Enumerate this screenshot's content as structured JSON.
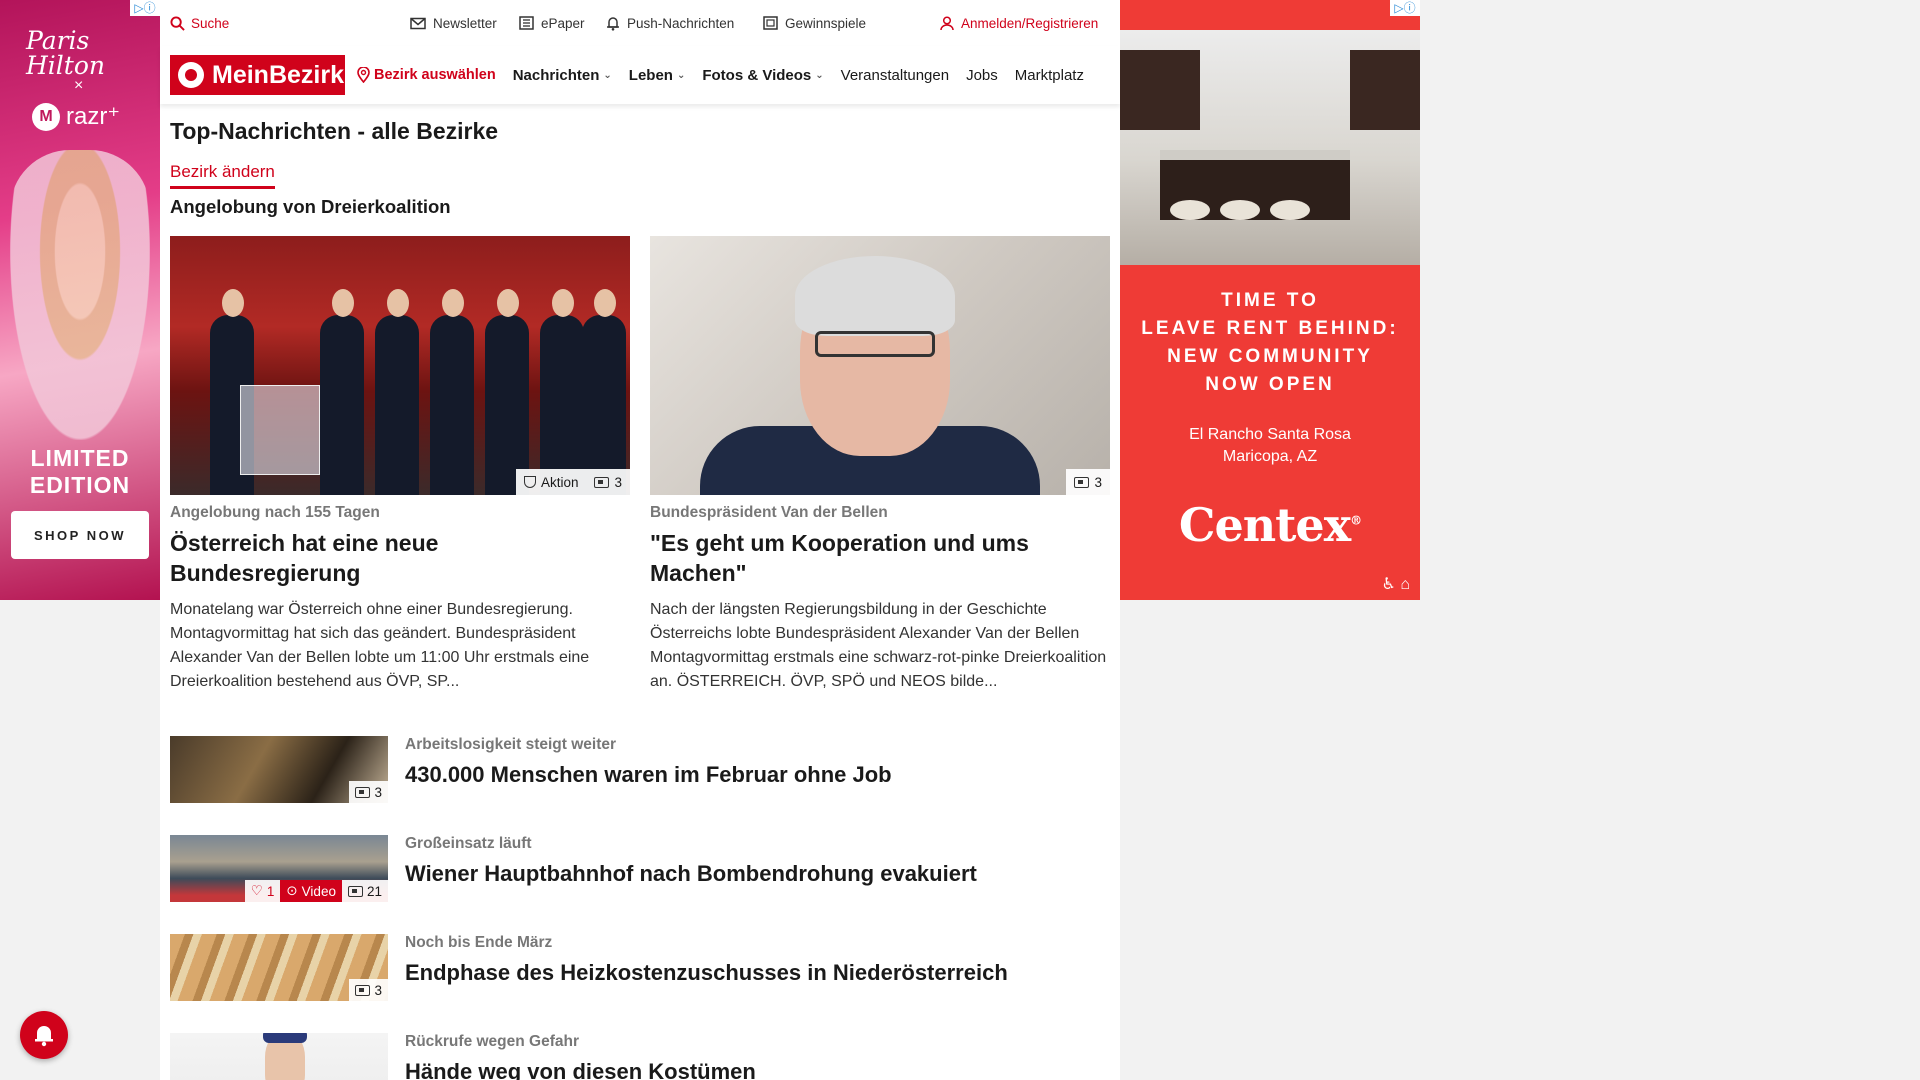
{
  "ads": {
    "left": {
      "brand": "Paris Hilton",
      "cross": "×",
      "partner": "razr⁺",
      "headline_line1": "LIMITED",
      "headline_line2": "EDITION",
      "cta": "SHOP NOW"
    },
    "right": {
      "headline_lines": [
        "TIME TO",
        "LEAVE RENT BEHIND:",
        "NEW COMMUNITY",
        "NOW OPEN"
      ],
      "location_line1": "El Rancho Santa Rosa",
      "location_line2": "Maricopa, AZ",
      "brand": "Centex",
      "brand_mark": "®"
    },
    "adchoice": "▷ⓘ"
  },
  "utility_bar": {
    "search": "Suche",
    "newsletter": "Newsletter",
    "epaper": "ePaper",
    "push": "Push-Nachrichten",
    "gewinnspiele": "Gewinnspiele",
    "login": "Anmelden/Registrieren"
  },
  "nav": {
    "logo": "MeinBezirk",
    "bezirk": "Bezirk auswählen",
    "items": [
      "Nachrichten",
      "Leben",
      "Fotos & Videos",
      "Veranstaltungen",
      "Jobs",
      "Marktplatz"
    ]
  },
  "page": {
    "title": "Top-Nachrichten - alle Bezirke",
    "change_bezirk": "Bezirk ändern",
    "section": "Angelobung von Dreierkoalition"
  },
  "hero_articles": [
    {
      "kicker": "Angelobung nach 155 Tagen",
      "headline": "Österreich hat eine neue Bundesregierung",
      "teaser": "Monatelang war Österreich ohne einer Bundesregierung. Montagvormittag hat sich das geändert. Bundespräsident Alexander Van der Bellen lobte um 11:00 Uhr erstmals eine Dreierkoalition bestehend aus ÖVP, SP...",
      "badge_label": "Aktion",
      "image_count": "3"
    },
    {
      "kicker": "Bundespräsident Van der Bellen",
      "headline": "\"Es geht um Kooperation und ums Machen\"",
      "teaser": "Nach der längsten Regierungsbildung in der Geschichte Österreichs lobte Bundespräsident Alexander Van der Bellen Montagvormittag erstmals eine schwarz-rot-pinke Dreierkoalition an. ÖSTERREICH. ÖVP, SPÖ und NEOS bilde...",
      "image_count": "3"
    }
  ],
  "list_articles": [
    {
      "kicker": "Arbeitslosigkeit steigt weiter",
      "headline": "430.000 Menschen waren im Februar ohne Job",
      "image_count": "3"
    },
    {
      "kicker": "Großeinsatz läuft",
      "headline": "Wiener Hauptbahnhof nach Bombendrohung evakuiert",
      "likes": "1",
      "video_label": "Video",
      "image_count": "21"
    },
    {
      "kicker": "Noch bis Ende März",
      "headline": "Endphase des Heizkostenzuschusses in Niederösterreich",
      "image_count": "3"
    },
    {
      "kicker": "Rückrufe wegen Gefahr",
      "headline": "Hände weg von diesen Kostümen"
    }
  ],
  "colors": {
    "brand_red": "#d0021b"
  },
  "icons": {
    "search": "search-icon",
    "newsletter": "envelope-icon",
    "epaper": "newspaper-icon",
    "push": "bell-icon",
    "gewinnspiele": "gift-icon",
    "login": "user-icon",
    "bezirk": "location-pin-icon"
  }
}
